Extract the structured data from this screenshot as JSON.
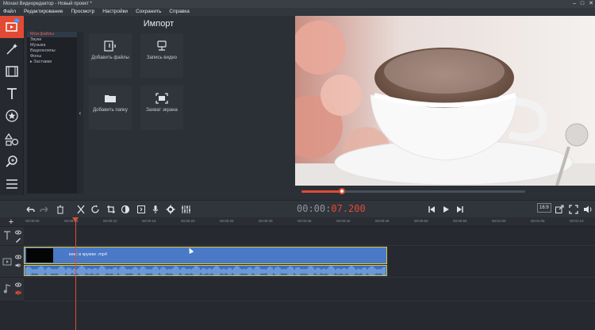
{
  "window": {
    "title": "Movavi Видеоредактор - Новый проект *",
    "controls": [
      "–",
      "□",
      "✕"
    ]
  },
  "menu": [
    "Файл",
    "Редактирование",
    "Просмотр",
    "Настройки",
    "Сохранить",
    "Справка"
  ],
  "left_tools": [
    "import-icon",
    "magic-wand-icon",
    "film-icon",
    "text-icon",
    "star-icon",
    "shapes-icon",
    "zoom-icon",
    "list-icon"
  ],
  "file_panel": {
    "items": [
      "Мои файлы",
      "Звуки",
      "Музыка",
      "Видеоклипы",
      "Фоны",
      "▸ Заставки"
    ]
  },
  "import": {
    "title": "Импорт",
    "tiles": [
      {
        "label": "Добавить файлы",
        "icon": "add-files-icon"
      },
      {
        "label": "Запись видео",
        "icon": "record-video-icon"
      },
      {
        "label": "Добавить папку",
        "icon": "folder-icon"
      },
      {
        "label": "Захват экрана",
        "icon": "screen-capture-icon"
      }
    ]
  },
  "playback": {
    "progress_fraction": 0.18
  },
  "timecode": {
    "current": "00:00:",
    "total": "07.200"
  },
  "aspect_ratio": "16:9",
  "ruler_ticks": [
    "00:00:00",
    "00:00:05",
    "00:00:10",
    "00:00:15",
    "00:00:20",
    "00:00:25",
    "00:00:30",
    "00:00:35",
    "00:00:40",
    "00:00:45",
    "00:00:50",
    "00:00:55",
    "00:01:00",
    "00:01:05",
    "00:01:10",
    "00:01:15"
  ],
  "clip": {
    "name": "кекс в кружке .mp4"
  },
  "colors": {
    "accent": "#e24a35",
    "clip": "#4a79c7",
    "clip_border": "#d8c34a"
  }
}
